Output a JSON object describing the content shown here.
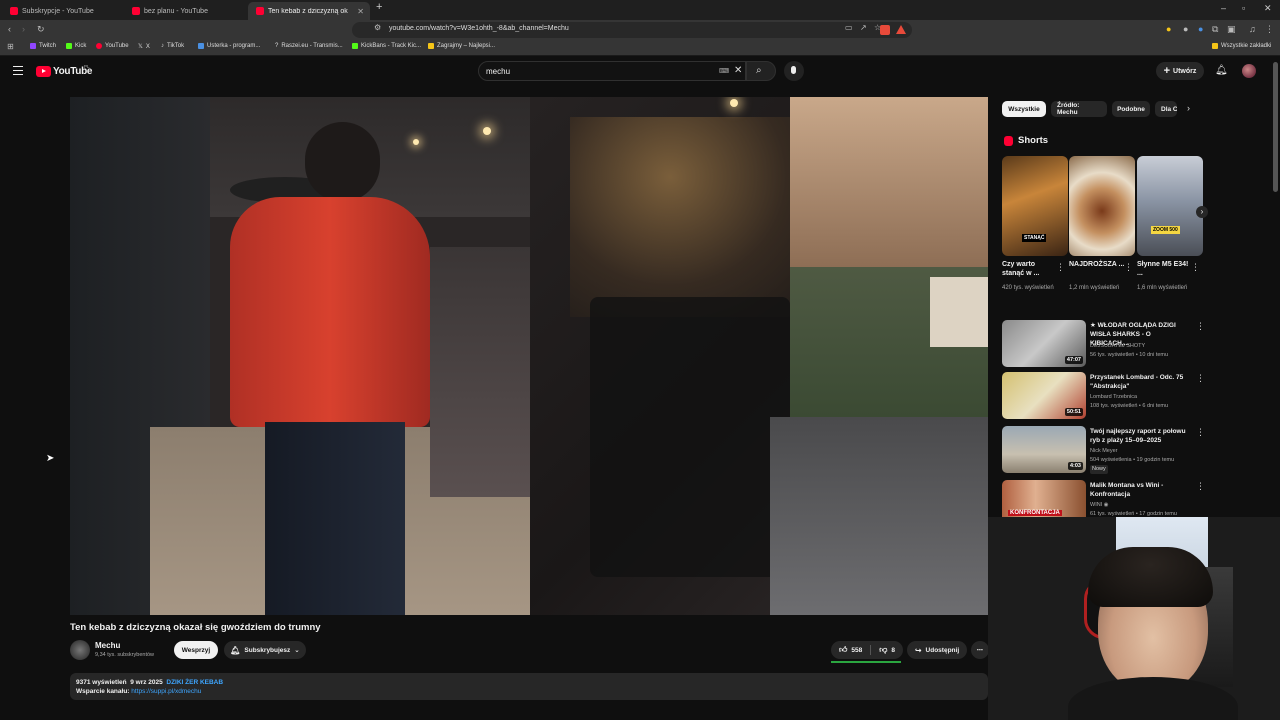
{
  "tabs": [
    {
      "label": "Subskrypcje - YouTube"
    },
    {
      "label": "bez planu - YouTube"
    },
    {
      "label": "Ten kebab z dziczyzną okazał"
    }
  ],
  "address_bar": {
    "url": "youtube.com/watch?v=W3e1ohth_-8&ab_channel=Mechu"
  },
  "bookmarks": [
    {
      "label": "Twitch",
      "color": "#9146ff"
    },
    {
      "label": "Kick",
      "color": "#53fc18"
    },
    {
      "label": "YouTube",
      "color": "#ff0033"
    },
    {
      "label": "X",
      "color": "#ffffff"
    },
    {
      "label": "TikTok",
      "color": "#ffffff"
    },
    {
      "label": "Usterka - program...",
      "color": "#4a90e2"
    },
    {
      "label": "Raszei.eu - Transmis...",
      "color": "#e0e0e0"
    },
    {
      "label": "KickBans - Track Kic...",
      "color": "#53fc18"
    },
    {
      "label": "Zagrajmy – Najlepsi...",
      "color": "#f5c518"
    }
  ],
  "all_bookmarks": "Wszystkie zakładki",
  "youtube": {
    "logo": "YouTube",
    "region": "PL",
    "search_value": "mechu",
    "create_label": "Utwórz"
  },
  "video": {
    "title": "Ten kebab z dziczyzną okazał się gwoździem do trumny",
    "channel": "Mechu",
    "subscribers": "9,34 tys. subskrybentów",
    "support_label": "Wesprzyj",
    "subscribed_label": "Subskrybujesz",
    "likes": "558",
    "dislikes": "8",
    "share_label": "Udostępnij",
    "description_views": "9371 wyświetleń",
    "description_date": "9 wrz 2025",
    "description_tag": "DZIKI ŻER KEBAB",
    "support_text": "Wsparcie kanału:",
    "support_link": "https://suppi.pl/xdmechu"
  },
  "chips": [
    "Wszystkie",
    "Źródło: Mechu",
    "Podobne",
    "Dla C"
  ],
  "shorts_heading": "Shorts",
  "shorts": [
    {
      "title": "Czy warto stanąć w ...",
      "views": "420 tys. wyświetleń",
      "overlay": "STANĄĆ"
    },
    {
      "title": "NAJDROŻSZA ...",
      "views": "1,2 mln wyświetleń",
      "overlay": ""
    },
    {
      "title": "Słynne M5 E34! ...",
      "views": "1,6 mln wyświetleń",
      "overlay": "ZOOM 500"
    }
  ],
  "recommendations": [
    {
      "title": "★ WŁODAR OGLĄDA DZIGI WISŁA SHARKS - O KIBICACH,...",
      "channel": "DEJSUBATEJ SHOTY",
      "meta": "56 tys. wyświetleń • 10 dni temu",
      "duration": "47:07",
      "badge": ""
    },
    {
      "title": "Przystanek Lombard - Odc. 75 \"Abstrakcja\"",
      "channel": "Lombard Trzebnica",
      "meta": "108 tys. wyświetleń • 6 dni temu",
      "duration": "50:51",
      "badge": ""
    },
    {
      "title": "Twój najlepszy raport z połowu ryb z plaży 15–09–2025",
      "channel": "Nick Meyer",
      "meta": "504 wyświetlenia • 19 godzin temu",
      "duration": "4:03",
      "badge": "Nowy"
    },
    {
      "title": "Malik Montana vs Wini - Konfrontacja",
      "channel": "WINI",
      "meta": "61 tys. wyświetleń • 17 godzin temu",
      "duration": "",
      "badge": ""
    }
  ],
  "thumb_overlay": "KONFRONTACJA"
}
